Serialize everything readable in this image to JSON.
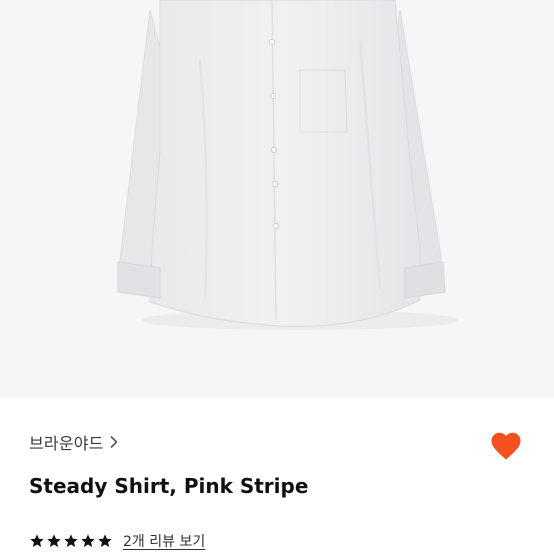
{
  "product_image": {
    "alt": ""
  },
  "brand": {
    "name": "브라운야드",
    "chevron_icon": "chevron-right-icon"
  },
  "like": {
    "icon": "heart-icon",
    "color": "#f4511e",
    "active": true
  },
  "product": {
    "title": "Steady Shirt, Pink Stripe"
  },
  "rating": {
    "stars": 5,
    "max": 5,
    "star_color": "#111111"
  },
  "reviews": {
    "link_label": "2개 리뷰 보기"
  }
}
